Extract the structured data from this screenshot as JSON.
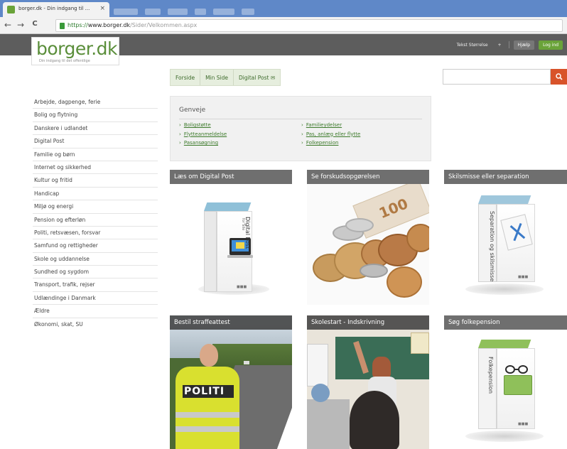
{
  "browser": {
    "tab_title": "borger.dk - Din indgang til ...",
    "tab_close": "×",
    "nav_back": "←",
    "nav_forward": "→",
    "nav_reload": "C",
    "url_secure": "https://",
    "url_domain": "www.borger.dk",
    "url_path": "/Sider/Velkommen.aspx"
  },
  "site": {
    "logo_text": "borger.dk",
    "logo_tagline": "Din indgang  til det offentlige",
    "header_links": {
      "text_size": "Tekst Størrelse",
      "separator_plus": "+",
      "help_button": "Hjælp",
      "login_button": "Log ind"
    },
    "subtabs": [
      "Forside",
      "Min Side",
      "Digital Post"
    ],
    "search": {
      "placeholder": "",
      "icon": "search-icon"
    },
    "accent_color": "#6aa339",
    "search_button_color": "#d8532a"
  },
  "sidebar": {
    "items": [
      "Arbejde, dagpenge, ferie",
      "Bolig og flytning",
      "Danskere i udlandet",
      "Digital Post",
      "Familie og børn",
      "Internet og sikkerhed",
      "Kultur og fritid",
      "Handicap",
      "Miljø og energi",
      "Pension og efterløn",
      "Politi, retsvæsen, forsvar",
      "Samfund og rettigheder",
      "Skole og uddannelse",
      "Sundhed og sygdom",
      "Transport, trafik, rejser",
      "Udlændinge i Danmark",
      "Ældre",
      "Økonomi, skat, SU"
    ]
  },
  "genveje": {
    "title": "Genveje",
    "left_links": [
      "Boligstøtte",
      "Flytteanmeldelse",
      "Pasansøgning"
    ],
    "right_links": [
      "Familieydelser",
      "Pas, anlæg eller flytte",
      "Folkepension"
    ]
  },
  "cards": [
    {
      "title": "Læs om Digital Post",
      "box_label": "Digital Post",
      "box_sublabel": "for alle"
    },
    {
      "title": "Se forskudsopgørelsen",
      "box_label": ""
    },
    {
      "title": "Skilsmisse eller separation",
      "box_label": "Separation og skilsmisse"
    },
    {
      "title": "Bestil straffeattest",
      "photo_text": "POLITI"
    },
    {
      "title": "Skolestart - Indskrivning"
    },
    {
      "title": "Søg folkepension",
      "box_label": "Folkepension"
    }
  ]
}
